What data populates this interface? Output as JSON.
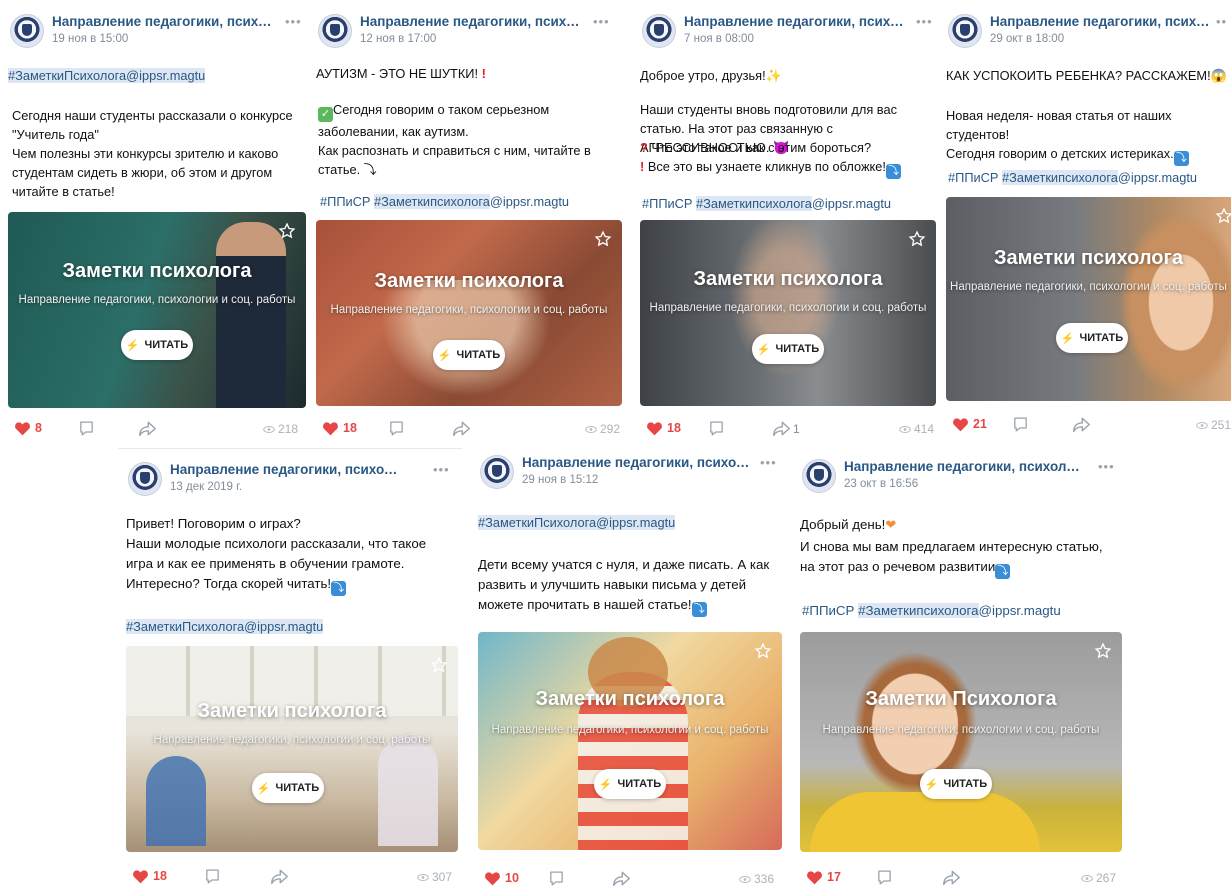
{
  "group_name": "Направление педагогики, психологии...",
  "more_icon": "more-horizontal-icon",
  "cover_button_label": "ЧИТАТЬ",
  "cover_subtitle": "Направление педагогики, психологии и соц. работы",
  "colors": {
    "link": "#2a5885",
    "like": "#e64646",
    "meta": "#818c99"
  },
  "posts": [
    {
      "date": "19 ноя в 15:00",
      "hashtag_line": "#ЗаметкиПсихолога@ippsr.magtu",
      "body": "Сегодня наши студенты рассказали о конкурсе \"Учитель года\"\nЧем полезны эти конкурсы зрителю и каково студентам сидеть в жюри, об этом и другом читайте в статье!",
      "cover_title": "Заметки психолога",
      "likes": "8",
      "views": "218"
    },
    {
      "date": "12 ноя в 17:00",
      "headline": "АУТИЗМ - ЭТО НЕ ШУТКИ!",
      "body": "Сегодня говорим о таком серьезном заболевании, как аутизм.\nКак распознать и справиться с ним, читайте в статье.",
      "hashtag_prefix": "#ППиСР",
      "hashtag_tag": "#Заметкипсихолога",
      "hashtag_suffix": "@ippsr.magtu",
      "cover_title": "Заметки психолога",
      "likes": "18",
      "views": "292"
    },
    {
      "date": "7 ноя в 08:00",
      "headline": "Доброе утро, друзья!",
      "body": "Наши студенты вновь подготовили для вас статью. На этот раз связанную с АГРЕССИВНОСТЬЮ.",
      "line2": "Что это такое и как с этим бороться?",
      "line3": "Все это вы узнаете кликнув по обложке!",
      "hashtag_prefix": "#ППиСР",
      "hashtag_tag": "#Заметкипсихолога",
      "hashtag_suffix": "@ippsr.magtu",
      "cover_title": "Заметки психолога",
      "likes": "18",
      "shares": "1",
      "views": "414"
    },
    {
      "date": "29 окт в 18:00",
      "headline": "КАК УСПОКОИТЬ РЕБЕНКА? РАССКАЖЕМ!",
      "body": "Новая неделя- новая статья от наших студентов!\nСегодня говорим о детских истериках.",
      "hashtag_prefix": "#ППиСР",
      "hashtag_tag": "#Заметкипсихолога",
      "hashtag_suffix": "@ippsr.magtu",
      "cover_title": "Заметки психолога",
      "likes": "21",
      "views": "251"
    },
    {
      "date": "13 дек 2019 г.",
      "body": "Привет! Поговорим о играх?\nНаши молодые психологи рассказали, что такое игра и как ее применять в обучении грамоте.\nИнтересно? Тогда скорей читать!",
      "hashtag_line": "#ЗаметкиПсихолога@ippsr.magtu",
      "cover_title": "Заметки психолога",
      "likes": "18",
      "views": "307"
    },
    {
      "date": "29 ноя в 15:12",
      "hashtag_line": "#ЗаметкиПсихолога@ippsr.magtu",
      "body": "Дети всему учатся с нуля, и даже писать. А как развить и улучшить навыки письма у детей можете прочитать в нашей статье!",
      "cover_title": "Заметки психолога",
      "likes": "10",
      "views": "336"
    },
    {
      "date": "23 окт в 16:56",
      "headline": "Добрый день!",
      "body": "И снова мы вам предлагаем интересную статью, на этот раз о речевом развитии",
      "hashtag_prefix": "#ППиСР",
      "hashtag_tag": "#Заметкипсихолога",
      "hashtag_suffix": "@ippsr.magtu",
      "cover_title": "Заметки Психолога",
      "likes": "17",
      "views": "267"
    }
  ]
}
